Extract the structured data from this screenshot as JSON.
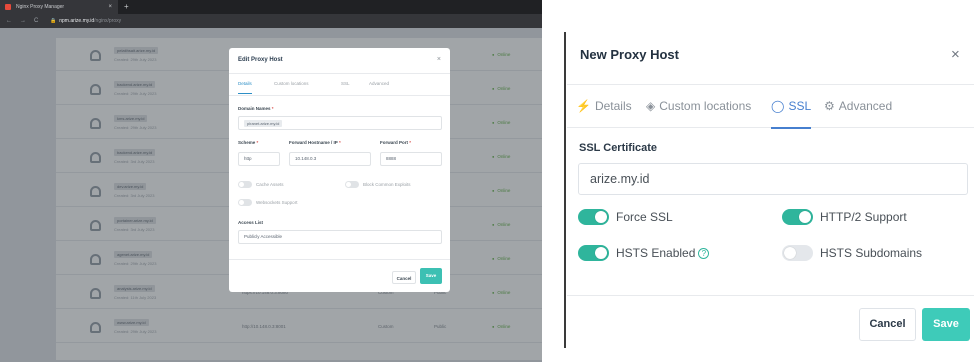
{
  "browser": {
    "tab_title": "Nginx Proxy Manager",
    "tab_close": "×",
    "new_tab": "+",
    "back": "←",
    "forward": "→",
    "reload": "C",
    "lock": "🔒",
    "url_host": "npm.arize.my.id",
    "url_path": "/nginx/proxy"
  },
  "background_list": {
    "rows": [
      {
        "domain": "pelatihsait.arize.my.id",
        "created": "Created: 29th July 2023",
        "destination": "",
        "ssl": "",
        "access": "",
        "status": "Online"
      },
      {
        "domain": "backend.arize.my.id",
        "created": "Created: 29th July 2023",
        "destination": "",
        "ssl": "",
        "access": "",
        "status": "Online"
      },
      {
        "domain": "kms.arize.my.id",
        "created": "Created: 29th July 2023",
        "destination": "",
        "ssl": "",
        "access": "",
        "status": "Online"
      },
      {
        "domain": "backend.arize.my.id",
        "created": "Created: 3rd July 2023",
        "destination": "",
        "ssl": "",
        "access": "",
        "status": "Online"
      },
      {
        "domain": "dev.arize.my.id",
        "created": "Created: 3rd July 2023",
        "destination": "",
        "ssl": "",
        "access": "",
        "status": "Online"
      },
      {
        "domain": "portainer.arize.my.id",
        "created": "Created: 3rd July 2023",
        "destination": "",
        "ssl": "",
        "access": "",
        "status": "Online"
      },
      {
        "domain": "agenet.arize.my.id",
        "created": "Created: 29th July 2023",
        "destination": "",
        "ssl": "",
        "access": "",
        "status": "Online"
      },
      {
        "domain": "analysis.arize.my.id",
        "created": "Created: 11th July 2023",
        "destination": "https://10.148.0.3:8080",
        "ssl": "Custom",
        "access": "Public",
        "status": "Online"
      },
      {
        "domain": "www.arize.my.id",
        "created": "Created: 29th July 2023",
        "destination": "http://10.148.0.3:8001",
        "ssl": "Custom",
        "access": "Public",
        "status": "Online"
      }
    ]
  },
  "edit_modal": {
    "title": "Edit Proxy Host",
    "close": "×",
    "tabs": [
      "Details",
      "Custom locations",
      "SSL",
      "Advanced"
    ],
    "domain_label": "Domain Names",
    "domain_value": "plranet.arize.my.id",
    "scheme_label": "Scheme",
    "scheme_value": "http",
    "host_label": "Forward Hostname / IP",
    "host_value": "10.148.0.3",
    "port_label": "Forward Port",
    "port_value": "8888",
    "cache_label": "Cache Assets",
    "block_label": "Block Common Exploits",
    "websockets_label": "Websockets Support",
    "access_label": "Access List",
    "access_value": "Publicly Accessible",
    "required_mark": "*",
    "cancel_label": "Cancel",
    "save_label": "Save"
  },
  "modal": {
    "title": "New Proxy Host",
    "close": "×",
    "tabs": [
      {
        "label": "Details",
        "icon": "⚡"
      },
      {
        "label": "Custom locations",
        "icon": "◈"
      },
      {
        "label": "SSL",
        "icon": "◯"
      },
      {
        "label": "Advanced",
        "icon": "⚙"
      }
    ],
    "active_tab": "SSL",
    "ssl_certificate_label": "SSL Certificate",
    "ssl_certificate_value": "arize.my.id",
    "options": {
      "force_ssl": {
        "label": "Force SSL",
        "on": true
      },
      "http2": {
        "label": "HTTP/2 Support",
        "on": true
      },
      "hsts": {
        "label": "HSTS Enabled",
        "on": true,
        "help": "?"
      },
      "hsts_sub": {
        "label": "HSTS Subdomains",
        "on": false
      }
    },
    "cancel_label": "Cancel",
    "save_label": "Save"
  },
  "colors": {
    "accent": "#467fcf",
    "toggle_on": "#2fb59c",
    "save_button": "#3ecbb9",
    "status_online": "#6eb556"
  }
}
